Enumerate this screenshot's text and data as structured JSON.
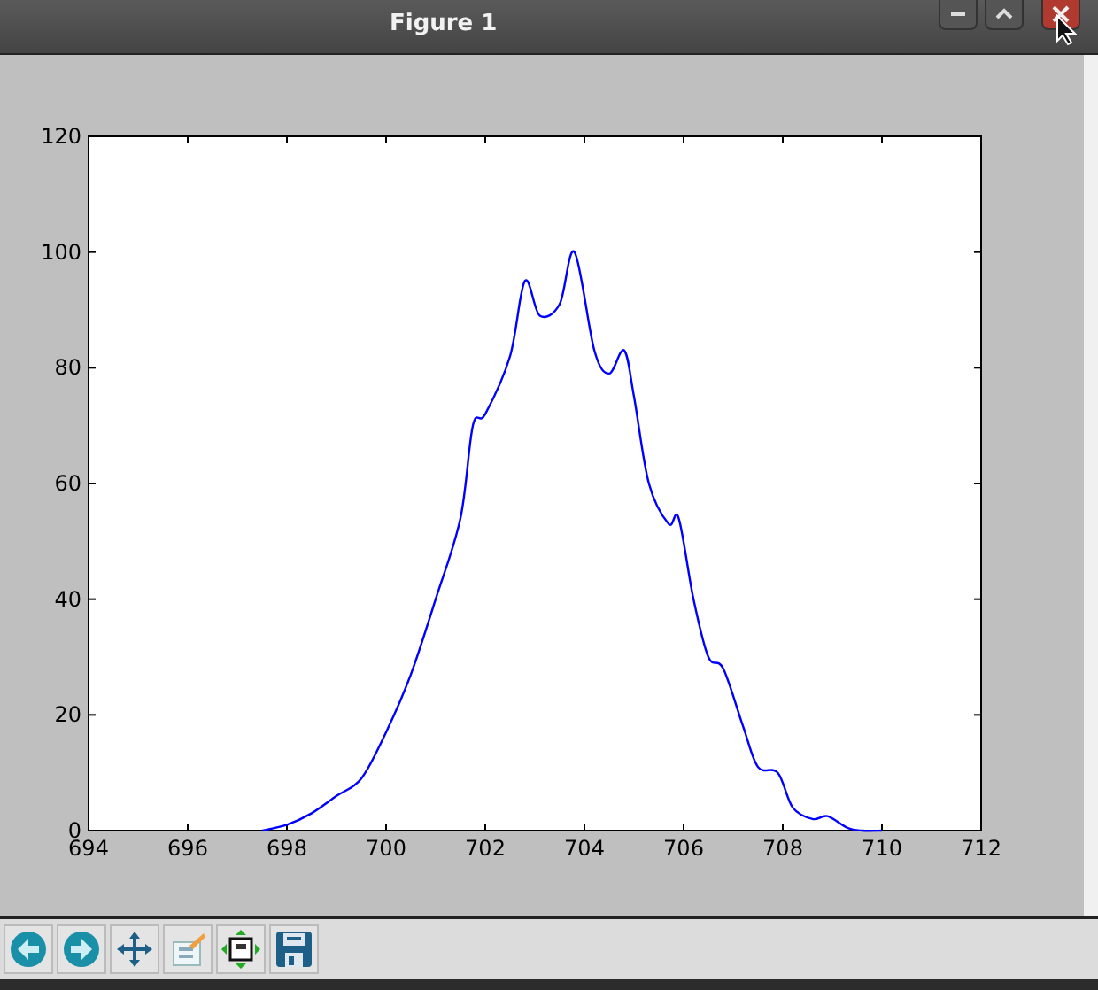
{
  "window": {
    "title": "Figure 1"
  },
  "figure": {
    "chart_data": {
      "type": "line",
      "x": [
        697.5,
        698,
        698.5,
        699,
        699.5,
        700,
        700.5,
        701,
        701.5,
        701.75,
        702,
        702.5,
        702.8,
        703.1,
        703.5,
        703.8,
        704.2,
        704.5,
        704.8,
        705,
        705.3,
        705.7,
        705.9,
        706.2,
        706.5,
        706.8,
        707.2,
        707.5,
        707.9,
        708.2,
        708.6,
        708.9,
        709.3,
        709.6,
        710
      ],
      "series": [
        {
          "color": "#0000ff",
          "values": [
            0,
            1,
            3,
            6,
            9,
            17,
            27,
            40,
            54,
            70,
            72,
            82,
            95,
            89,
            91,
            100,
            83,
            79,
            83,
            75,
            60,
            53,
            54,
            40,
            30,
            28,
            18,
            11,
            10,
            4,
            2,
            2.5,
            0.5,
            0,
            0
          ]
        }
      ],
      "xlim": [
        694,
        712
      ],
      "ylim": [
        0,
        120
      ],
      "xticks": [
        694,
        696,
        698,
        700,
        702,
        704,
        706,
        708,
        710,
        712
      ],
      "yticks": [
        0,
        20,
        40,
        60,
        80,
        100,
        120
      ]
    }
  },
  "toolbar": {
    "buttons": [
      {
        "kind": "back"
      },
      {
        "kind": "forward"
      },
      {
        "kind": "pan"
      },
      {
        "kind": "configure"
      },
      {
        "kind": "subplots"
      },
      {
        "kind": "save"
      }
    ]
  }
}
